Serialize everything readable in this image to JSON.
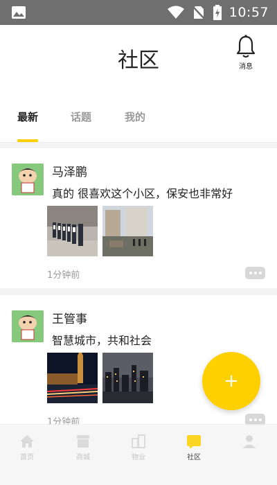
{
  "status_bar": {
    "time": "10:57"
  },
  "header": {
    "title": "社区",
    "bell_label": "消息"
  },
  "tabs": [
    {
      "label": "最新",
      "active": true
    },
    {
      "label": "话题",
      "active": false
    },
    {
      "label": "我的",
      "active": false
    }
  ],
  "posts": [
    {
      "author": "马泽鹏",
      "content": "真的 很喜欢这个小区，保安也非常好",
      "time_ago": "1分钟前"
    },
    {
      "author": "王管事",
      "content": "智慧城市，共和社会",
      "time_ago": "1分钟前"
    }
  ],
  "fab": {
    "label": "+"
  },
  "bottom_nav": [
    {
      "label": "首页",
      "icon": "home-icon"
    },
    {
      "label": "商城",
      "icon": "shop-icon"
    },
    {
      "label": "物业",
      "icon": "building-icon"
    },
    {
      "label": "社区",
      "icon": "community-icon",
      "active": true
    },
    {
      "label": "",
      "icon": "profile-icon"
    }
  ],
  "colors": {
    "accent": "#ffd000",
    "status_bar": "#6f6f6f",
    "muted_text": "#9a9a9a"
  }
}
